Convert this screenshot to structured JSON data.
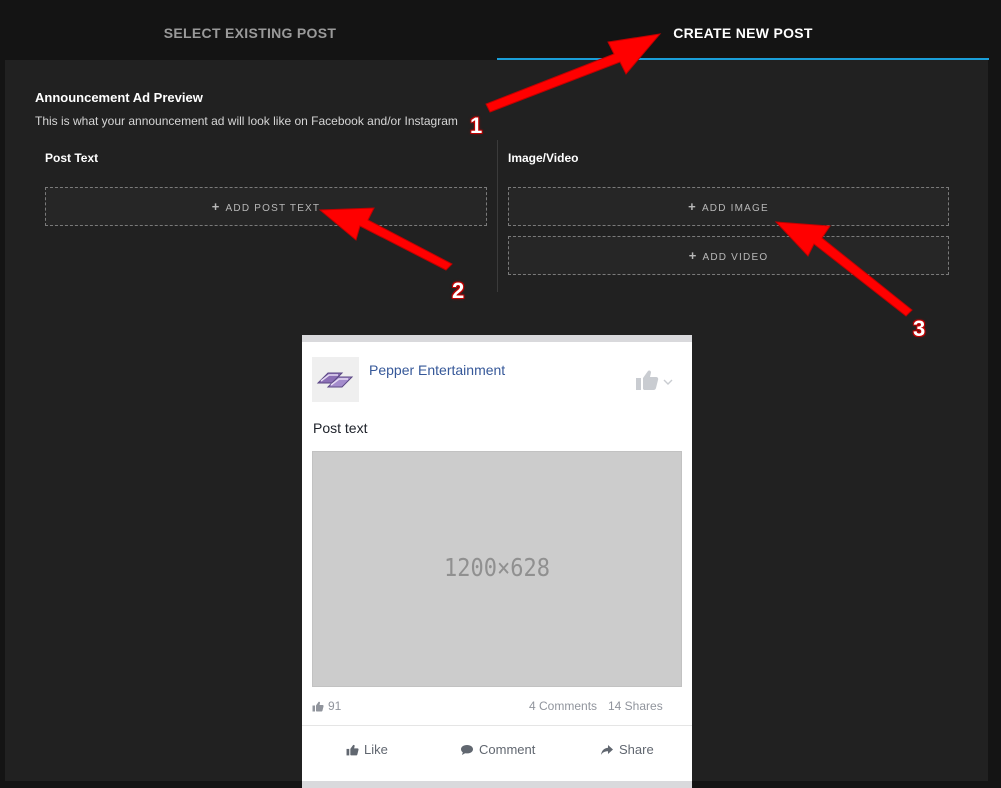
{
  "tabs": {
    "select_existing": "SELECT EXISTING POST",
    "create_new": "CREATE NEW POST"
  },
  "preview": {
    "heading": "Announcement Ad Preview",
    "description": "This is what your announcement ad will look like on Facebook and/or Instagram"
  },
  "post_text_section": {
    "title": "Post Text",
    "add_button": "ADD POST TEXT"
  },
  "media_section": {
    "title": "Image/Video",
    "add_image": "ADD IMAGE",
    "add_video": "ADD VIDEO"
  },
  "fb_card": {
    "page_name": "Pepper Entertainment",
    "post_text": "Post text",
    "image_placeholder": "1200×628",
    "likes": "91",
    "comments": "4 Comments",
    "shares": "14 Shares",
    "actions": {
      "like": "Like",
      "comment": "Comment",
      "share": "Share"
    }
  },
  "annotations": {
    "labels": [
      "1",
      "2",
      "3"
    ],
    "color": "#ff0000"
  },
  "colors": {
    "accent": "#1a9fd9",
    "facebook_link": "#365899"
  },
  "icons": {
    "plus": "+",
    "thumbs_up": "thumbs-up-icon",
    "comment": "comment-icon",
    "share": "share-icon"
  }
}
